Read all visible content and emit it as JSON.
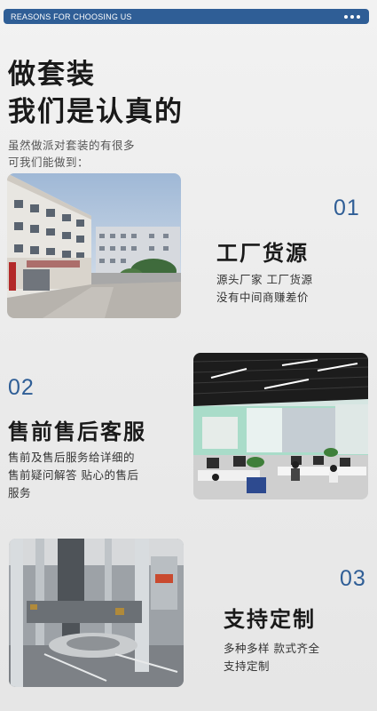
{
  "header": {
    "label": "REASONS FOR CHOOSING US",
    "menu_icon": "more-dots-icon"
  },
  "headline": {
    "line1": "做套装",
    "line2": "我们是认真的"
  },
  "intro": {
    "line1": "虽然做派对套装的有很多",
    "line2": "可我们能做到："
  },
  "sections": [
    {
      "number": "01",
      "title": "工厂货源",
      "desc_lines": [
        "源头厂家 工厂货源",
        "没有中间商赚差价"
      ]
    },
    {
      "number": "02",
      "title": "售前售后客服",
      "desc_lines": [
        "售前及售后服务给详细的",
        "售前疑问解答 贴心的售后",
        "服务"
      ]
    },
    {
      "number": "03",
      "title": "支持定制",
      "desc_lines": [
        "多种多样 款式齐全",
        "支持定制"
      ]
    }
  ],
  "colors": {
    "accent": "#2f5e96",
    "background": "#eeeeee"
  }
}
